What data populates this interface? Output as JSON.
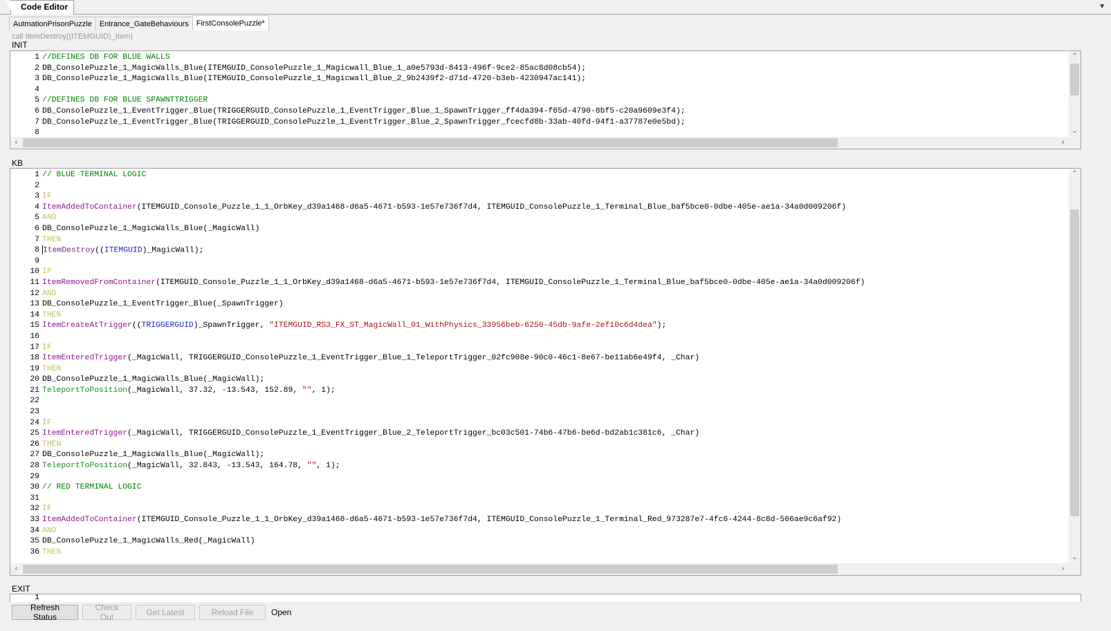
{
  "window": {
    "title": "Code Editor"
  },
  "tabs": [
    "AutmationPrisonPuzzle",
    "Entrance_GateBehaviours",
    "FirstConsolePuzzle*"
  ],
  "hint": "call ItemDestroy((ITEMGUID)_Item)",
  "sections": {
    "init": "INIT",
    "kb": "KB",
    "exit": "EXIT"
  },
  "init_lines": [
    {
      "n": "1",
      "t": "//DEFINES DB FOR BLUE WALLS"
    },
    {
      "n": "2",
      "t": "DB_ConsolePuzzle_1_MagicWalls_Blue(ITEMGUID_ConsolePuzzle_1_Magicwall_Blue_1_a0e5793d-8413-496f-9ce2-85ac8d08cb54);"
    },
    {
      "n": "3",
      "t": "DB_ConsolePuzzle_1_MagicWalls_Blue(ITEMGUID_ConsolePuzzle_1_Magicwall_Blue_2_9b2439f2-d71d-4720-b3eb-4230947ac141);"
    },
    {
      "n": "4",
      "t": ""
    },
    {
      "n": "5",
      "t": "//DEFINES DB FOR BLUE SPAWNTTRIGGER"
    },
    {
      "n": "6",
      "t": "DB_ConsolePuzzle_1_EventTrigger_Blue(TRIGGERGUID_ConsolePuzzle_1_EventTrigger_Blue_1_SpawnTrigger_ff4da394-f65d-4790-8bf5-c20a9609e3f4);"
    },
    {
      "n": "7",
      "t": "DB_ConsolePuzzle_1_EventTrigger_Blue(TRIGGERGUID_ConsolePuzzle_1_EventTrigger_Blue_2_SpawnTrigger_fcecfd8b-33ab-40fd-94f1-a37787e0e5bd);"
    },
    {
      "n": "8",
      "t": ""
    }
  ],
  "kb_lines": [
    {
      "n": "1",
      "t": "// BLUE TERMINAL LOGIC"
    },
    {
      "n": "2",
      "t": ""
    },
    {
      "n": "3",
      "t": "IF"
    },
    {
      "n": "4",
      "f": "ItemAddedToContainer",
      "t": "(ITEMGUID_Console_Puzzle_1_1_OrbKey_d39a1468-d6a5-4671-b593-1e57e736f7d4, ITEMGUID_ConsolePuzzle_1_Terminal_Blue_baf5bce0-0dbe-405e-ae1a-34a0d009206f)"
    },
    {
      "n": "5",
      "t": "AND"
    },
    {
      "n": "6",
      "t": "DB_ConsolePuzzle_1_MagicWalls_Blue(_MagicWall)"
    },
    {
      "n": "7",
      "t": "THEN"
    },
    {
      "n": "8",
      "f": "ItemDestroy",
      "p": "((",
      "ty": "ITEMGUID",
      "t": ")_MagicWall);"
    },
    {
      "n": "9",
      "t": ""
    },
    {
      "n": "10",
      "t": "IF"
    },
    {
      "n": "11",
      "f": "ItemRemovedFromContainer",
      "t": "(ITEMGUID_Console_Puzzle_1_1_OrbKey_d39a1468-d6a5-4671-b593-1e57e736f7d4, ITEMGUID_ConsolePuzzle_1_Terminal_Blue_baf5bce0-0dbe-405e-ae1a-34a0d009206f)"
    },
    {
      "n": "12",
      "t": "AND"
    },
    {
      "n": "13",
      "t": "DB_ConsolePuzzle_1_EventTrigger_Blue(_SpawnTrigger)"
    },
    {
      "n": "14",
      "t": "THEN"
    },
    {
      "n": "15",
      "f": "ItemCreateAtTrigger",
      "p": "((",
      "ty": "TRIGGERGUID",
      "t": ")_SpawnTrigger, ",
      "s": "\"ITEMGUID_RS3_FX_ST_MagicWall_01_WithPhysics_33956beb-6250-45db-9afe-2ef10c6d4dea\"",
      "e": ");"
    },
    {
      "n": "16",
      "t": ""
    },
    {
      "n": "17",
      "t": "IF"
    },
    {
      "n": "18",
      "f": "ItemEnteredTrigger",
      "t": "(_MagicWall, TRIGGERGUID_ConsolePuzzle_1_EventTrigger_Blue_1_TeleportTrigger_02fc908e-90c0-46c1-8e67-be11ab6e49f4, _Char)"
    },
    {
      "n": "19",
      "t": "THEN"
    },
    {
      "n": "20",
      "t": "DB_ConsolePuzzle_1_MagicWalls_Blue(_MagicWall);"
    },
    {
      "n": "21",
      "f2": "TeleportToPosition",
      "t": "(_MagicWall, 37.32, -13.543, 152.89, ",
      "s": "\"\"",
      "e": ", 1);"
    },
    {
      "n": "22",
      "t": ""
    },
    {
      "n": "23",
      "t": ""
    },
    {
      "n": "24",
      "t": "IF"
    },
    {
      "n": "25",
      "f": "ItemEnteredTrigger",
      "t": "(_MagicWall, TRIGGERGUID_ConsolePuzzle_1_EventTrigger_Blue_2_TeleportTrigger_bc03c501-74b6-47b6-be6d-bd2ab1c381c6, _Char)"
    },
    {
      "n": "26",
      "t": "THEN"
    },
    {
      "n": "27",
      "t": "DB_ConsolePuzzle_1_MagicWalls_Blue(_MagicWall);"
    },
    {
      "n": "28",
      "f2": "TeleportToPosition",
      "t": "(_MagicWall, 32.843, -13.543, 164.78, ",
      "s": "\"\"",
      "e": ", 1);"
    },
    {
      "n": "29",
      "t": ""
    },
    {
      "n": "30",
      "t": "// RED TERMINAL LOGIC"
    },
    {
      "n": "31",
      "t": ""
    },
    {
      "n": "32",
      "t": "IF"
    },
    {
      "n": "33",
      "f": "ItemAddedToContainer",
      "t": "(ITEMGUID_Console_Puzzle_1_1_OrbKey_d39a1468-d6a5-4671-b593-1e57e736f7d4, ITEMGUID_ConsolePuzzle_1_Terminal_Red_973287e7-4fc6-4244-8c8d-566ae9c6af92)"
    },
    {
      "n": "34",
      "t": "AND"
    },
    {
      "n": "35",
      "t": "DB_ConsolePuzzle_1_MagicWalls_Red(_MagicWall)"
    },
    {
      "n": "36",
      "t": "THEN"
    }
  ],
  "exit_lines": [
    {
      "n": "1",
      "t": ""
    }
  ],
  "buttons": {
    "refresh": "Refresh Status",
    "checkout": "Check Out",
    "getlatest": "Get Latest",
    "reload": "Reload File"
  },
  "status": "Open"
}
